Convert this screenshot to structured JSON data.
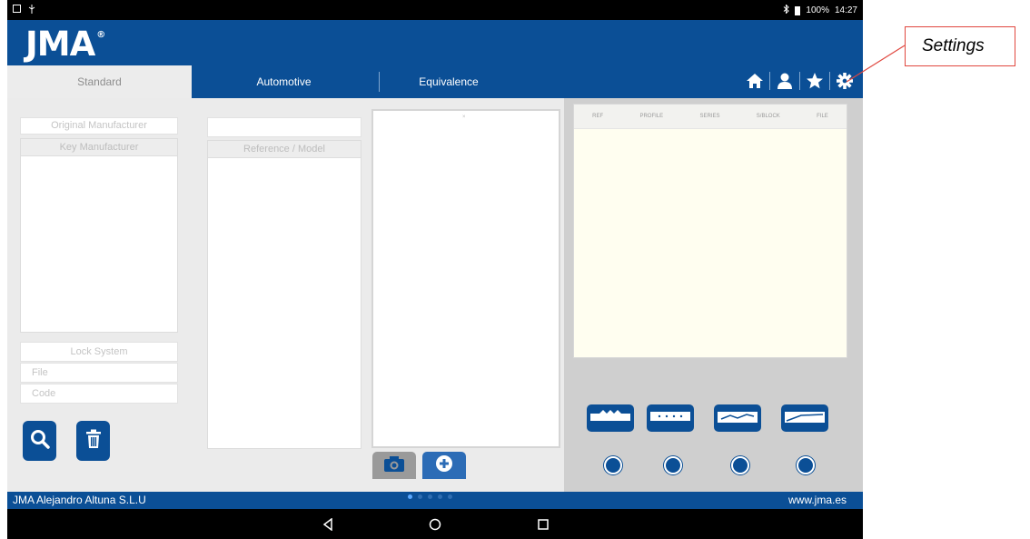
{
  "status_bar": {
    "battery": "100%",
    "time": "14:27"
  },
  "brand": {
    "logo_text": "JMA",
    "registered": "®"
  },
  "tabs": [
    {
      "label": "Standard"
    },
    {
      "label": "Automotive"
    },
    {
      "label": "Equivalence"
    }
  ],
  "toolbar": {
    "icons": [
      "home-icon",
      "user-icon",
      "star-icon",
      "gear-icon"
    ]
  },
  "left_panel": {
    "original_manufacturer_placeholder": "Original Manufacturer",
    "key_manufacturer_header": "Key Manufacturer",
    "lock_system_placeholder": "Lock System",
    "file_placeholder": "File",
    "code_placeholder": "Code"
  },
  "middle_panel": {
    "search_value": "",
    "reference_model_header": "Reference / Model"
  },
  "image_panel": {
    "marker": "×"
  },
  "results_table": {
    "columns": [
      "REF",
      "PROFILE",
      "SERIES",
      "S/BLOCK",
      "FILE"
    ]
  },
  "footer": {
    "company": "JMA Alejandro Altuna S.L.U",
    "website": "www.jma.es"
  },
  "annotation": {
    "label": "Settings"
  },
  "colors": {
    "brand_blue": "#0b4f96",
    "panel_gray": "#ebebeb",
    "results_bg": "#fffef0",
    "callout_red": "#e0473f"
  }
}
